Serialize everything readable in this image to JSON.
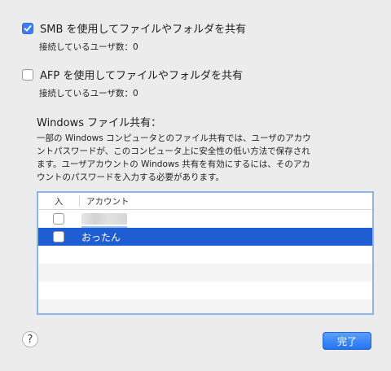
{
  "smb": {
    "checked": true,
    "label": "SMB を使用してファイルやフォルダを共有",
    "connected": "接続しているユーザ数：0"
  },
  "afp": {
    "checked": false,
    "label": "AFP を使用してファイルやフォルダを共有",
    "connected": "接続しているユーザ数：0"
  },
  "windows": {
    "title": "Windows ファイル共有：",
    "lines": [
      "一部の Windows コンピュータとのファイル共有では、ユーザのアカウ",
      "ントパスワードが、このコンピュータ上に安全性の低い方法で保存され",
      "ます。ユーザアカウントの Windows 共有を有効にするには、そのアカ",
      "ウントのパスワードを入力する必要があります。"
    ]
  },
  "table": {
    "col_in": "入",
    "col_account": "アカウント",
    "rows": [
      {
        "enabled": false,
        "account": "",
        "selected": false
      },
      {
        "enabled": false,
        "account": "おったん",
        "selected": true
      }
    ]
  },
  "footer": {
    "help": "?",
    "done": "完了"
  },
  "icons": {
    "check": "checkmark-icon",
    "help": "question-mark-icon"
  },
  "colors": {
    "accent": "#3b7ef0",
    "selection": "#1f5dd3",
    "table_border": "#8fb4ec"
  }
}
